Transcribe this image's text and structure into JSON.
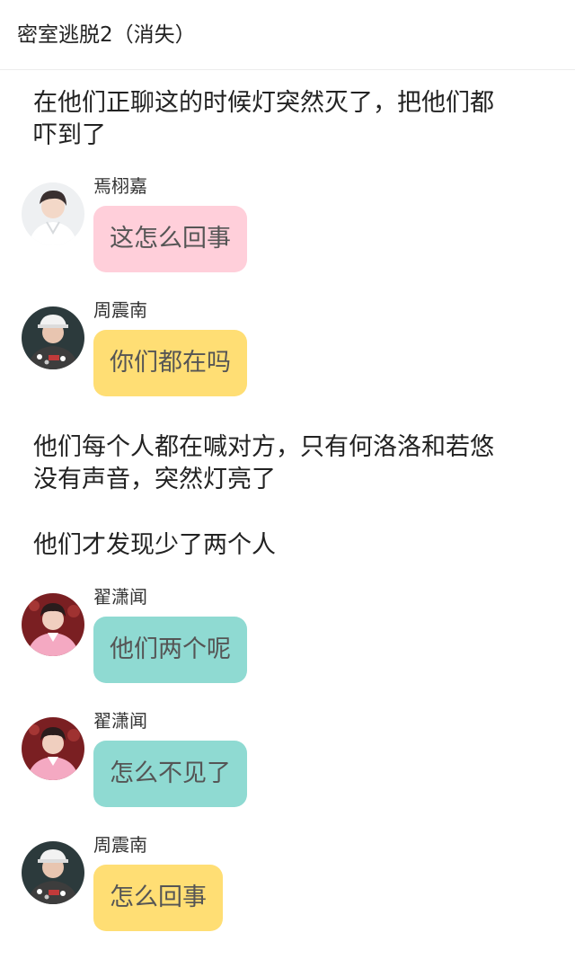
{
  "header": {
    "title": "密室逃脱2（消失）"
  },
  "colors": {
    "pink_bubble": "#ffcfda",
    "yellow_bubble": "#ffde74",
    "teal_bubble": "#8fdad2"
  },
  "story": [
    {
      "type": "narration",
      "lines": [
        "在他们正聊这的时候灯突然灭了，把他们都",
        "吓到了"
      ]
    },
    {
      "type": "message",
      "sender": "焉栩嘉",
      "text": "这怎么回事",
      "bubble_color": "pink",
      "avatar_icon": "avatar-white-outfit-icon"
    },
    {
      "type": "message",
      "sender": "周震南",
      "text": "你们都在吗",
      "bubble_color": "yellow",
      "avatar_icon": "avatar-cap-jacket-icon"
    },
    {
      "type": "narration",
      "lines": [
        "他们每个人都在喊对方，只有何洛洛和若悠",
        "没有声音，突然灯亮了"
      ]
    },
    {
      "type": "narration",
      "lines": [
        "他们才发现少了两个人"
      ]
    },
    {
      "type": "message",
      "sender": "翟潇闻",
      "text": "他们两个呢",
      "bubble_color": "teal",
      "avatar_icon": "avatar-pink-suit-icon"
    },
    {
      "type": "message",
      "sender": "翟潇闻",
      "text": "怎么不见了",
      "bubble_color": "teal",
      "avatar_icon": "avatar-pink-suit-icon"
    },
    {
      "type": "message",
      "sender": "周震南",
      "text": "怎么回事",
      "bubble_color": "yellow",
      "avatar_icon": "avatar-cap-jacket-icon"
    }
  ]
}
